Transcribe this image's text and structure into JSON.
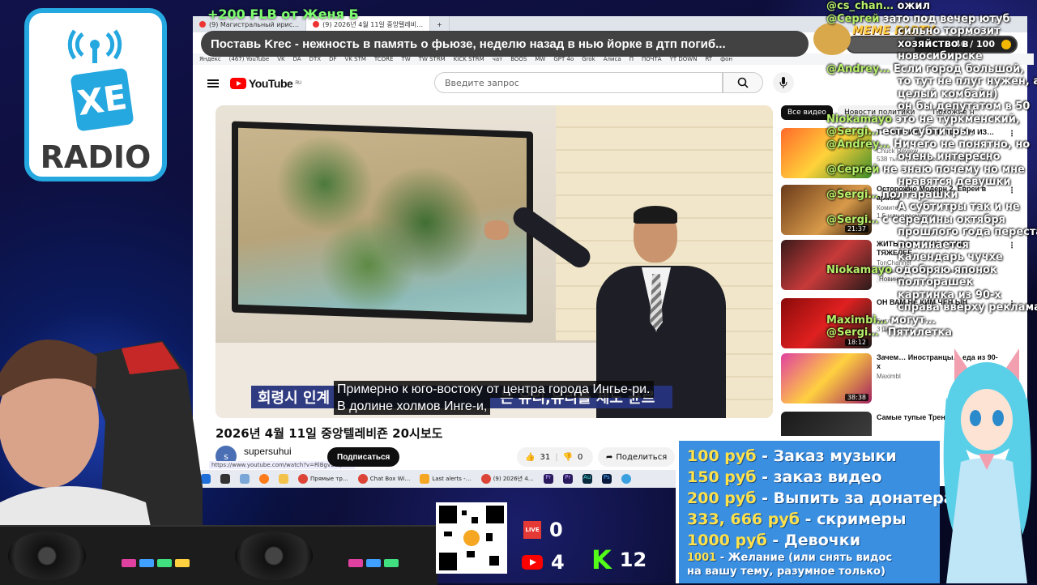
{
  "overlay": {
    "top_alert": "+200 FLB   от Женя Б",
    "meme_party": {
      "label": "MEME PARTY",
      "counter": "40 / 100",
      "progress": 0.4
    },
    "logo": {
      "brand": "XE",
      "subtitle": "RADIO"
    }
  },
  "browser": {
    "tabs": [
      {
        "label": "(9) Магистральный ирис…",
        "active": false
      },
      {
        "label": "(9) 2026년 4월 11일 중앙텔레비…",
        "active": true
      },
      {
        "label": "+",
        "active": false
      }
    ],
    "marquee": "Поставь Krec - нежность в память о фьюзе, неделю назад в нью йорке в дтп погиб...",
    "bookmarks": [
      "Яндекс",
      "(467) YouTube",
      "VK",
      "DA",
      "DTX",
      "DF",
      "VK STM",
      "TCORE",
      "TW",
      "TW STRM",
      "KICK STRM",
      "чат",
      "BOOS",
      "MW",
      "GPT 4o",
      "Grok",
      "Алиса",
      "П",
      "ПОЧТА",
      "YT DOWN",
      "RT",
      "фон"
    ]
  },
  "youtube": {
    "logo_text": "YouTube",
    "logo_region": "RU",
    "search_placeholder": "Введите запрос",
    "video": {
      "korean_banner": "회령시 인계",
      "korean_banner_right": "는 유리,유리를 제도 균르",
      "subtitle_line1": "Примерно к юго-востоку от центра города Ингье-ри.",
      "subtitle_line2": "В долине холмов Инге-и,",
      "title": "2026년 4월 11일 중앙텔레비죤 20시보도",
      "channel": "supersuhui",
      "channel_initial": "s",
      "status_url": "https://www.youtube.com/watch?v=RlBgv2cQAa0",
      "subscribe": "Подписаться",
      "likes": "31",
      "dislikes": "0",
      "share": "Поделиться"
    },
    "chips": [
      {
        "label": "Все видео",
        "active": true
      },
      {
        "label": "Новости политики",
        "active": false
      },
      {
        "label": "Похожие н",
        "active": false
      }
    ],
    "recommendations": [
      {
        "title": "ТУПЕЙШИЙ… ИГРУШКАМИ ИЗ…",
        "meta1": "Chuck Review",
        "meta2": "538 тыс. просмотров • 3 недели назад",
        "duration": ""
      },
      {
        "title": "Осторожно Модерн 2. Евреи в арабы",
        "meta1": "Комитет",
        "meta2": "1,5 млн просмотров",
        "duration": "21:37"
      },
      {
        "title": "ЖИТЬ В РОССИИ СТАНЕТ ТЯЖЕЛЕЕ",
        "meta1": "TonChannel",
        "meta2": "5,4 тыс. просмотров • 8 часов назад",
        "badge": "Новинка",
        "duration": ""
      },
      {
        "title": "ОН ВАМ НЕ КИМ ЧЕН ЫН",
        "meta1": "Битл 36",
        "meta2": "3 дня назад",
        "duration": "18:12"
      },
      {
        "title": "Зачем… Иностранцы… еда из 90-х",
        "meta1": "Maximbl",
        "meta2": "",
        "duration": "38:38"
      },
      {
        "title": "Самые тупые Тренды ТикТока",
        "meta1": "",
        "meta2": "",
        "duration": ""
      }
    ]
  },
  "taskbar": {
    "items": [
      "Прямые тр…",
      "Chat Box Wi…",
      "Last alerts -…",
      "(9) 2026년 4…",
      "Pr",
      "Pr",
      "Au",
      "Ps"
    ]
  },
  "chat": {
    "lines": [
      {
        "nick": "@cs_chan…",
        "text": "ожил"
      },
      {
        "nick": "@Сергей",
        "text": "зато под вечер ютуб"
      },
      {
        "nick": "",
        "text": "сильно тормозит"
      },
      {
        "nick": "",
        "text": "хозяйство в"
      },
      {
        "nick": "",
        "text": "новосибирске"
      },
      {
        "nick": "@Andrey…",
        "text": "Если город большой,"
      },
      {
        "nick": "",
        "text": "то тут не плуг нужен, а"
      },
      {
        "nick": "",
        "text": "целый комбайн)"
      },
      {
        "nick": "",
        "text": "он бы депутатом в 50"
      },
      {
        "nick": "Niokamayo",
        "text": "это не туркменский,"
      },
      {
        "nick": "@Sergi…",
        "text": "есть субтитры."
      },
      {
        "nick": "@Andrey…",
        "text": "Ничего не понятно, но"
      },
      {
        "nick": "",
        "text": "очень интересно"
      },
      {
        "nick": "@Сергей",
        "text": "не знаю почему но мне"
      },
      {
        "nick": "",
        "text": "нравятся девушки"
      },
      {
        "nick": "@Sergi…",
        "text": "полтарашки"
      },
      {
        "nick": "",
        "text": "А субтитры так и не"
      },
      {
        "nick": "@Sergi…",
        "text": "с середины октября"
      },
      {
        "nick": "",
        "text": "прошлого года перестал"
      },
      {
        "nick": "",
        "text": "поминается"
      },
      {
        "nick": "",
        "text": "календарь чучхе"
      },
      {
        "nick": "Niokamayo",
        "text": "одобряю японок"
      },
      {
        "nick": "",
        "text": "полторашек"
      },
      {
        "nick": "",
        "text": "картинка из 90-х"
      },
      {
        "nick": "",
        "text": "справа вверху реклама"
      },
      {
        "nick": "Maximbi…",
        "text": "могут…"
      },
      {
        "nick": "@Sergi…",
        "text": "\"Пятилетка"
      }
    ]
  },
  "donations": {
    "rows": [
      {
        "price": "100 руб",
        "text": " - Заказ музыки"
      },
      {
        "price": "150 руб",
        "text": " - заказ видео"
      },
      {
        "price": "200 руб",
        "text": " - Выпить за донатера"
      },
      {
        "price": "333, 666 руб",
        "text": " - скримеры"
      },
      {
        "price": "1000 руб",
        "text": " - Девочки"
      }
    ],
    "last_price": "1001",
    "last_text_1": " - Желание (или снять видос",
    "last_text_2": "на вашу тему, разумное только)"
  },
  "stats": {
    "live_label": "LIVE",
    "live_count": "0",
    "youtube_count": "4",
    "kick_letter": "K",
    "kick_count": "12"
  },
  "colors": {
    "youtube_red": "#ff0000",
    "kick_green": "#53fc18",
    "donate_bg": "#3a8fe0",
    "alert_green": "#7dff6e"
  }
}
